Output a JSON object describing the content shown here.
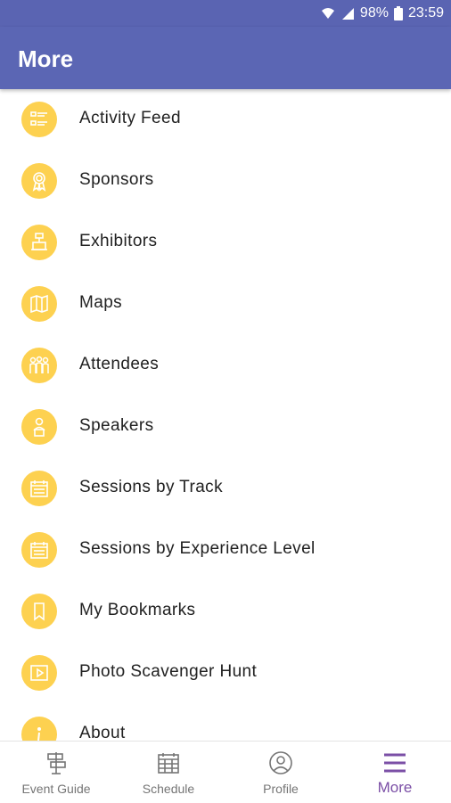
{
  "status_bar": {
    "battery": "98%",
    "time": "23:59",
    "icons": [
      "wifi-icon",
      "signal-icon",
      "battery-icon"
    ]
  },
  "app_bar": {
    "title": "More"
  },
  "colors": {
    "app_bar": "#5b66b4",
    "icon_circle": "#fdd150",
    "active_tab": "#7b4fa6"
  },
  "menu": {
    "items": [
      {
        "label": "Activity Feed",
        "icon": "list-icon"
      },
      {
        "label": "Sponsors",
        "icon": "award-ribbon-icon"
      },
      {
        "label": "Exhibitors",
        "icon": "booth-icon"
      },
      {
        "label": "Maps",
        "icon": "map-icon"
      },
      {
        "label": "Attendees",
        "icon": "people-icon"
      },
      {
        "label": "Speakers",
        "icon": "speaker-icon"
      },
      {
        "label": "Sessions by Track",
        "icon": "calendar-icon"
      },
      {
        "label": "Sessions by Experience Level",
        "icon": "calendar-icon"
      },
      {
        "label": "My Bookmarks",
        "icon": "bookmark-icon"
      },
      {
        "label": "Photo Scavenger Hunt",
        "icon": "play-icon"
      },
      {
        "label": "About",
        "icon": "info-icon"
      }
    ]
  },
  "bottom_nav": {
    "tabs": [
      {
        "label": "Event Guide",
        "icon": "signpost-icon"
      },
      {
        "label": "Schedule",
        "icon": "calendar-grid-icon"
      },
      {
        "label": "Profile",
        "icon": "user-circle-icon"
      },
      {
        "label": "More",
        "icon": "menu-icon"
      }
    ],
    "active": "More"
  }
}
